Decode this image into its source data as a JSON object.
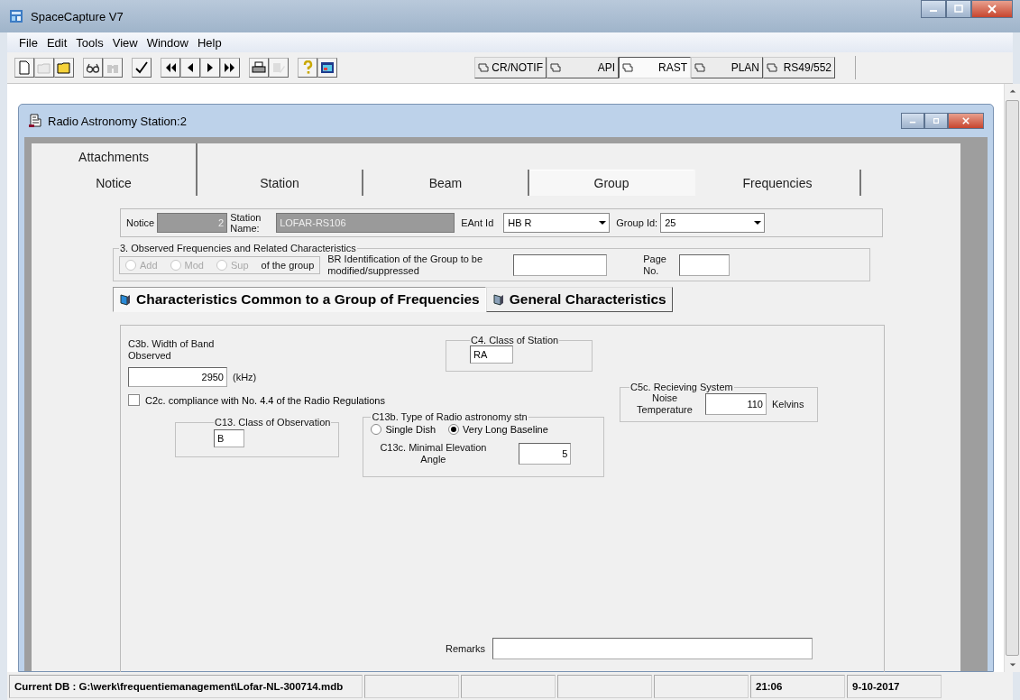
{
  "window": {
    "title": "SpaceCapture V7"
  },
  "menu": [
    "File",
    "Edit",
    "Tools",
    "View",
    "Window",
    "Help"
  ],
  "toolbar": [
    [
      {
        "kind": "new",
        "disabled": false
      },
      {
        "kind": "open",
        "disabled": true
      },
      {
        "kind": "folder",
        "disabled": false
      }
    ],
    [
      {
        "kind": "glasses",
        "disabled": false
      },
      {
        "kind": "binoculars",
        "disabled": true
      }
    ],
    [
      {
        "kind": "check",
        "disabled": false
      }
    ],
    [
      {
        "kind": "first",
        "disabled": false
      },
      {
        "kind": "prev",
        "disabled": false
      },
      {
        "kind": "next",
        "disabled": false
      },
      {
        "kind": "last",
        "disabled": false
      }
    ],
    [
      {
        "kind": "print",
        "disabled": false
      },
      {
        "kind": "edit",
        "disabled": true
      }
    ],
    [
      {
        "kind": "help",
        "disabled": false
      },
      {
        "kind": "screen",
        "disabled": false
      }
    ]
  ],
  "module_tabs": [
    {
      "label": "CR/NOTIF",
      "selected": false
    },
    {
      "label": "API",
      "selected": false
    },
    {
      "label": "RAST",
      "selected": true
    },
    {
      "label": "PLAN",
      "selected": false
    },
    {
      "label": "RS49/552",
      "selected": false
    }
  ],
  "child_window": {
    "title": "Radio Astronomy Station:2"
  },
  "tabs_row_1": [
    {
      "label": "Attachments",
      "selected": false
    }
  ],
  "tabs": [
    {
      "label": "Notice",
      "selected": false
    },
    {
      "label": "Station",
      "selected": false
    },
    {
      "label": "Beam",
      "selected": false
    },
    {
      "label": "Group",
      "selected": true
    },
    {
      "label": "Frequencies",
      "selected": false
    }
  ],
  "header": {
    "notice_label": "Notice",
    "notice_value": "2",
    "station_label": "Station Name:",
    "station_value": "LOFAR-RS106",
    "eant_label": "EAnt Id",
    "eant_value": "HB R",
    "group_label": "Group Id:",
    "group_value": "25"
  },
  "observed": {
    "legend": "3. Observed Frequencies and Related Characteristics",
    "options": [
      {
        "label": "Add",
        "selected": false,
        "disabled": true
      },
      {
        "label": "Mod",
        "selected": false,
        "disabled": true
      },
      {
        "label": "Sup",
        "selected": false,
        "disabled": true
      }
    ],
    "options_suffix": "of the group",
    "br_label": "BR Identification of the Group to be modified/suppressed",
    "page_label": "Page No."
  },
  "subtabs": [
    {
      "label": "Characteristics Common to a Group of Frequencies",
      "selected": true
    },
    {
      "label": "General Characteristics",
      "selected": false
    }
  ],
  "bandwidth": {
    "label": "C3b. Width of Band Observed",
    "value": "2950",
    "unit": "(kHz)"
  },
  "class_of_station": {
    "legend": "C4. Class of Station",
    "value": "RA"
  },
  "compliance": {
    "label": "C2c. compliance with No. 4.4 of the Radio Regulations",
    "checked": false
  },
  "receiving_system": {
    "legend": "C5c. Recieving System",
    "label": "Noise Temperature",
    "value": "110",
    "unit": "Kelvins"
  },
  "class_of_observation": {
    "legend": "C13. Class of Observation",
    "value": "B"
  },
  "station_type": {
    "legend": "C13b. Type of Radio astronomy stn",
    "options": [
      {
        "label": "Single Dish",
        "selected": false
      },
      {
        "label": "Very Long Baseline",
        "selected": true
      }
    ],
    "elevation_label": "C13c.  Minimal Elevation Angle",
    "elevation_value": "5"
  },
  "remarks": {
    "label": "Remarks"
  },
  "status_bar": {
    "db": "Current DB : G:\\werk\\frequentiemanagement\\Lofar-NL-300714.mdb",
    "time": "21:06",
    "date": "9-10-2017"
  }
}
